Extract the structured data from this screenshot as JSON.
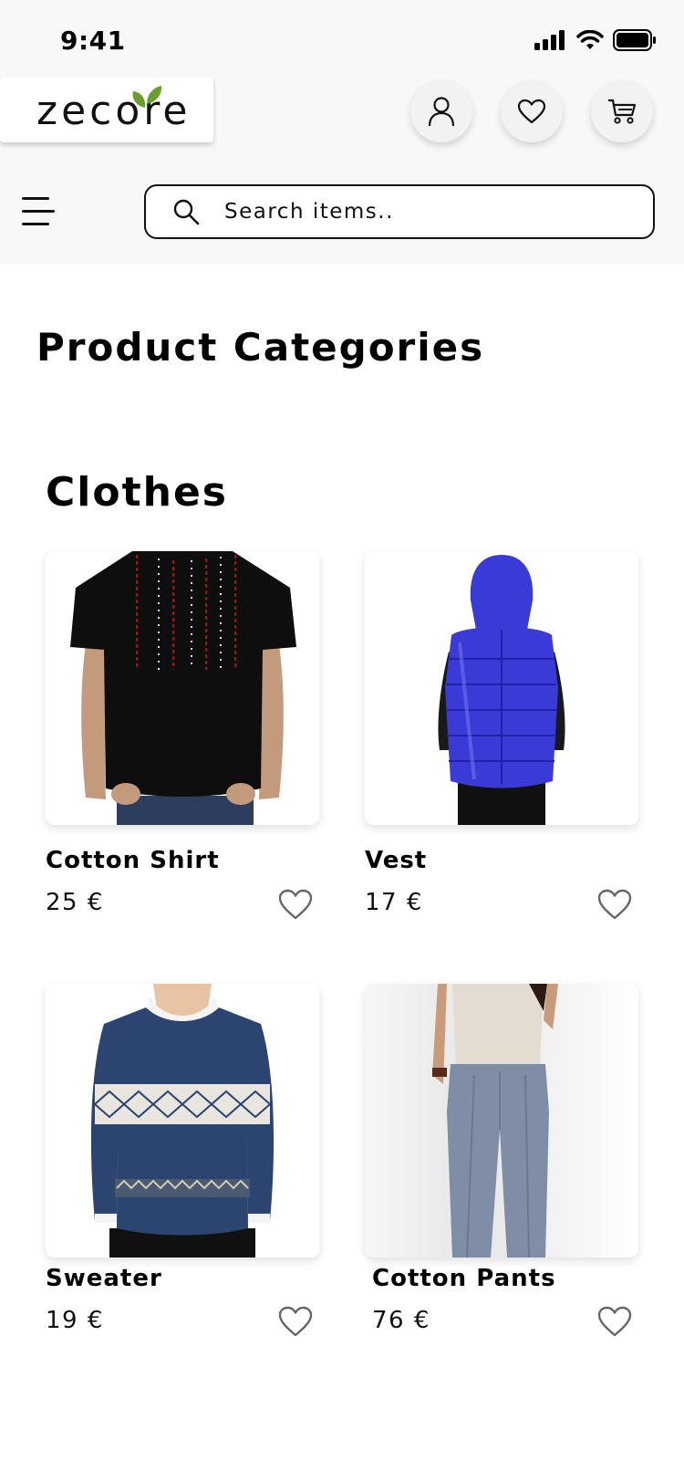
{
  "status": {
    "time": "9:41"
  },
  "brand": {
    "logo_text": "zecore"
  },
  "header": {
    "icons": [
      "user-icon",
      "heart-icon",
      "cart-icon"
    ],
    "menu_icon": "hamburger-menu-icon"
  },
  "search": {
    "placeholder": "Search items.."
  },
  "page": {
    "title": "Product Categories"
  },
  "category": {
    "title": "Clothes",
    "products": [
      {
        "name": "Cotton Shirt",
        "price": "25 €",
        "favorite": false
      },
      {
        "name": "Vest",
        "price": "17 €",
        "favorite": false
      },
      {
        "name": "Sweater",
        "price": "19 €",
        "favorite": false
      },
      {
        "name": "Cotton Pants",
        "price": "76 €",
        "favorite": false
      }
    ]
  },
  "colors": {
    "leaf_green": "#6a9e2f",
    "leaf_brown": "#8a6a3a",
    "background_top": "#f8f8f8",
    "vest_blue": "#3a3ad6",
    "sweater_navy": "#2c4470"
  }
}
